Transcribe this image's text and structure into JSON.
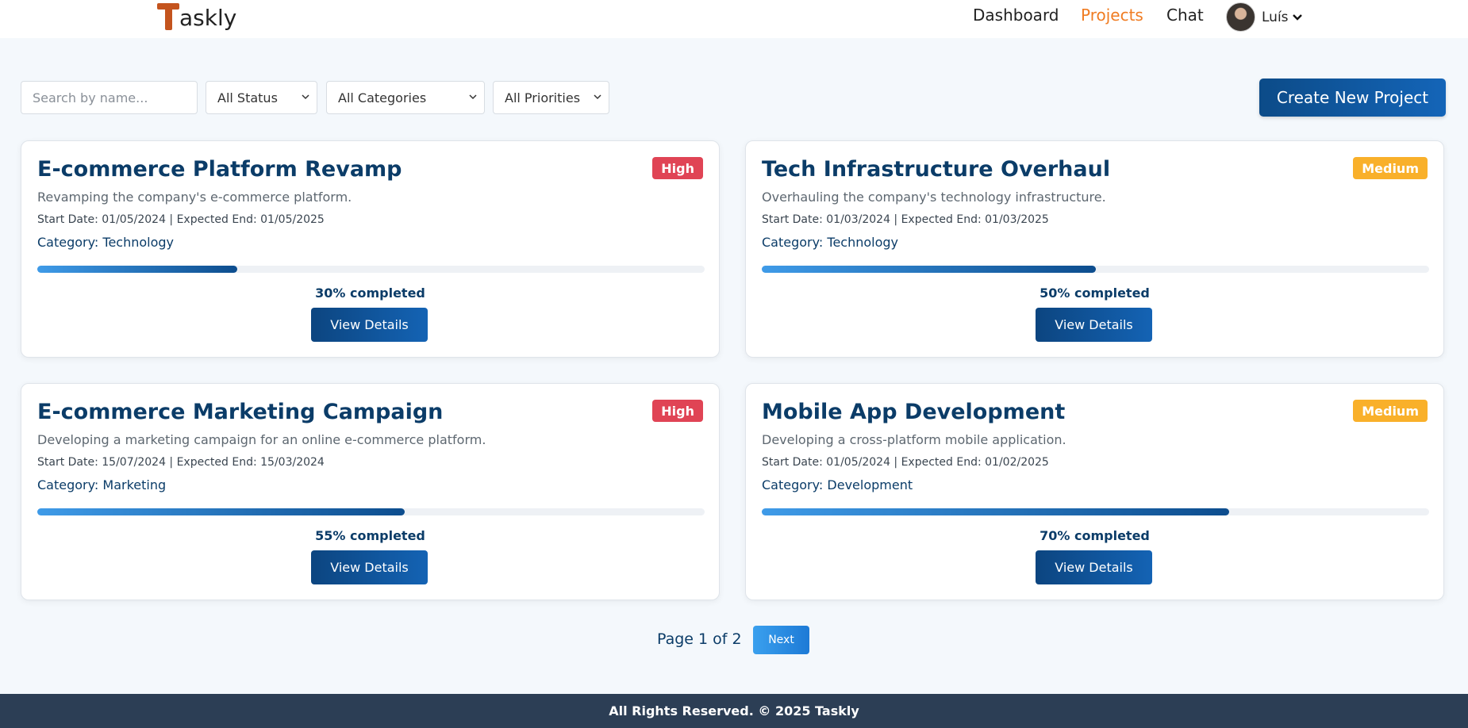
{
  "brand": {
    "name": "askly"
  },
  "nav": {
    "items": [
      {
        "label": "Dashboard",
        "active": false
      },
      {
        "label": "Projects",
        "active": true
      },
      {
        "label": "Chat",
        "active": false
      }
    ],
    "user_name": "Luís"
  },
  "filters": {
    "search_placeholder": "Search by name...",
    "status": "All Status",
    "categories": "All Categories",
    "priorities": "All Priorities",
    "create_label": "Create New Project"
  },
  "projects": [
    {
      "title": "E-commerce Platform Revamp",
      "priority": "High",
      "priority_color": "#e04455",
      "description": "Revamping the company's e-commerce platform.",
      "dates": "Start Date: 01/05/2024 | Expected End: 01/05/2025",
      "category": "Category: Technology",
      "progress": 30,
      "progress_label": "30% completed",
      "button": "View Details"
    },
    {
      "title": "Tech Infrastructure Overhaul",
      "priority": "Medium",
      "priority_color": "#f9b02a",
      "description": "Overhauling the company's technology infrastructure.",
      "dates": "Start Date: 01/03/2024 | Expected End: 01/03/2025",
      "category": "Category: Technology",
      "progress": 50,
      "progress_label": "50% completed",
      "button": "View Details"
    },
    {
      "title": "E-commerce Marketing Campaign",
      "priority": "High",
      "priority_color": "#e04455",
      "description": "Developing a marketing campaign for an online e-commerce platform.",
      "dates": "Start Date: 15/07/2024 | Expected End: 15/03/2024",
      "category": "Category: Marketing",
      "progress": 55,
      "progress_label": "55% completed",
      "button": "View Details"
    },
    {
      "title": "Mobile App Development",
      "priority": "Medium",
      "priority_color": "#f9b02a",
      "description": "Developing a cross-platform mobile application.",
      "dates": "Start Date: 01/05/2024 | Expected End: 01/02/2025",
      "category": "Category: Development",
      "progress": 70,
      "progress_label": "70% completed",
      "button": "View Details"
    }
  ],
  "pagination": {
    "text": "Page 1 of 2",
    "next_label": "Next"
  },
  "footer": {
    "text": "All Rights Reserved. © 2025 Taskly"
  }
}
